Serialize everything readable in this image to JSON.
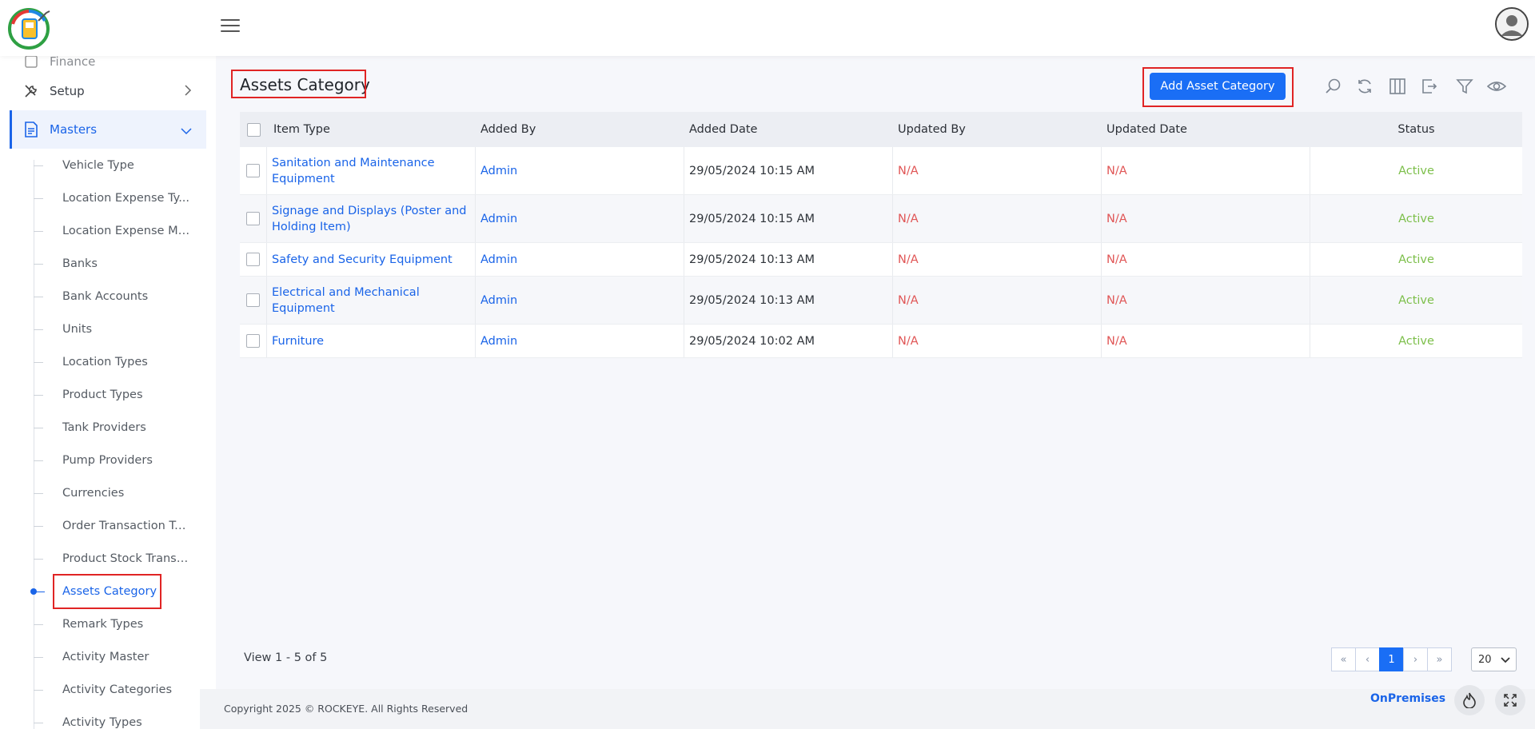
{
  "header": {
    "logo_icon": "fuel-station-logo-icon",
    "menu_icon": "hamburger-menu-icon",
    "avatar_icon": "user-avatar-icon"
  },
  "sidebar": {
    "partial_item": "Finance",
    "setup_label": "Setup",
    "masters_label": "Masters",
    "sub_items": [
      {
        "label": "Vehicle Type"
      },
      {
        "label": "Location Expense Ty..."
      },
      {
        "label": "Location Expense Ma..."
      },
      {
        "label": "Banks"
      },
      {
        "label": "Bank Accounts"
      },
      {
        "label": "Units"
      },
      {
        "label": "Location Types"
      },
      {
        "label": "Product Types"
      },
      {
        "label": "Tank Providers"
      },
      {
        "label": "Pump Providers"
      },
      {
        "label": "Currencies"
      },
      {
        "label": "Order Transaction Ty..."
      },
      {
        "label": "Product Stock Transa..."
      },
      {
        "label": "Assets Category"
      },
      {
        "label": "Remark Types"
      },
      {
        "label": "Activity Master"
      },
      {
        "label": "Activity Categories"
      },
      {
        "label": "Activity Types"
      }
    ],
    "active_sub_item": "Assets Category"
  },
  "main": {
    "title": "Assets Category",
    "add_button": "Add Asset Category",
    "toolbar_icons": [
      "search-icon",
      "refresh-icon",
      "columns-icon",
      "export-icon",
      "filter-icon",
      "eye-icon"
    ]
  },
  "table": {
    "headers": {
      "item_type": "Item Type",
      "added_by": "Added By",
      "added_date": "Added Date",
      "updated_by": "Updated By",
      "updated_date": "Updated Date",
      "status": "Status"
    },
    "rows": [
      {
        "item_type": "Sanitation and Maintenance Equipment",
        "added_by": "Admin",
        "added_date": "29/05/2024 10:15 AM",
        "updated_by": "N/A",
        "updated_date": "N/A",
        "status": "Active"
      },
      {
        "item_type": "Signage and Displays (Poster and Holding Item)",
        "added_by": "Admin",
        "added_date": "29/05/2024 10:15 AM",
        "updated_by": "N/A",
        "updated_date": "N/A",
        "status": "Active"
      },
      {
        "item_type": "Safety and Security Equipment",
        "added_by": "Admin",
        "added_date": "29/05/2024 10:13 AM",
        "updated_by": "N/A",
        "updated_date": "N/A",
        "status": "Active"
      },
      {
        "item_type": "Electrical and Mechanical Equipment",
        "added_by": "Admin",
        "added_date": "29/05/2024 10:13 AM",
        "updated_by": "N/A",
        "updated_date": "N/A",
        "status": "Active"
      },
      {
        "item_type": "Furniture",
        "added_by": "Admin",
        "added_date": "29/05/2024 10:02 AM",
        "updated_by": "N/A",
        "updated_date": "N/A",
        "status": "Active"
      }
    ]
  },
  "pagination": {
    "view_info": "View 1 - 5 of 5",
    "first": "«",
    "prev": "‹",
    "current_page": "1",
    "next": "›",
    "last": "»",
    "page_size": "20"
  },
  "footer": {
    "copyright": "Copyright 2025 © ROCKEYE. All Rights Reserved",
    "mode": "OnPremises",
    "fire_icon": "flame-icon",
    "fullscreen_icon": "fullscreen-icon"
  },
  "colors": {
    "accent": "#1a6ef5",
    "link": "#1a64e8",
    "na": "#e05656",
    "active_status": "#7cbf4a",
    "highlight_box": "#e02424"
  }
}
